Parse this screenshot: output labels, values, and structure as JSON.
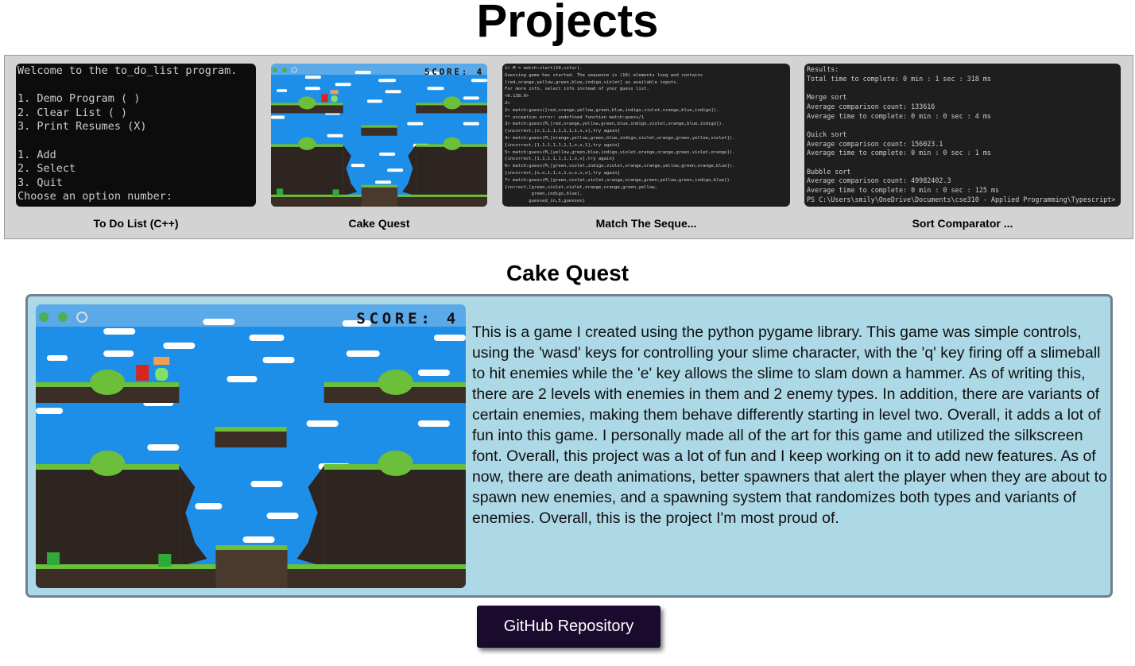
{
  "page": {
    "title": "Projects"
  },
  "projects": [
    {
      "label": "To Do List (C++)",
      "screenshot_lines": [
        "Welcome to the to_do_list program.",
        "",
        "1. Demo Program ( )",
        "2. Clear List ( )",
        "3. Print Resumes (X)",
        "",
        "1. Add",
        "2. Select",
        "3. Quit",
        "Choose an option number:"
      ]
    },
    {
      "label": "Cake Quest",
      "score_text": "SCORE: 4"
    },
    {
      "label": "Match The Seque...",
      "screenshot_lines": [
        "1> M = match:start(10,color).",
        "Guessing game has started. The sequence is (10) elements long and contains",
        "[red,orange,yellow,green,blue,indigo,violet] as available inputs.",
        "For more info, select info instead of your guess list.",
        "<0.138.0>",
        "2>",
        "2> match:guess([red,orange,yellow,green,blue,indigo,violet,orange,blue,indigo]).",
        "** exception error: undefined function match:guess/1",
        "3> match:guess(M,[red,orange,yellow,green,blue,indigo,violet,orange,blue,indigo]).",
        "{incorrect,[x,1,1,1,1,1,1,1,x,x],try again}",
        "4> match:guess(M,[orange,yellow,green,blue,indigo,violet,orange,green,yellow,violet]).",
        "{incorrect,[1,1,1,1,1,1,1,o,x,1],try again}",
        "5> match:guess(M,[yellow,green,blue,indigo,violet,orange,orange,green,violet,orange]).",
        "{incorrect,[1,1,1,1,1,1,1,o,x],try again}",
        "6> match:guess(M,[green,violet,indigo,violet,orange,orange,yellow,green,orange,blue]).",
        "{incorrect,[o,o,1,1,o,1,o,o,x,o],try again}",
        "7> match:guess(M,[green,violet,violet,orange,orange,green,yellow,green,indigo,blue]).",
        "{correct,[green,violet,violet,orange,orange,green,yellow,",
        "          green,indigo,blue],",
        "         guessed_in,5,guesses}",
        "8> "
      ]
    },
    {
      "label": "Sort Comparator ...",
      "screenshot_lines": [
        "Results:",
        "Total time to complete: 0 min : 1 sec : 318 ms",
        "",
        "Merge sort",
        "Average comparison count: 133616",
        "Average time to complete: 0 min : 0 sec : 4 ms",
        "",
        "Quick sort",
        "Average comparison count: 156023.1",
        "Average time to complete: 0 min : 0 sec : 1 ms",
        "",
        "Bubble sort",
        "Average comparison count: 49982402.3",
        "Average time to complete: 0 min : 0 sec : 125 ms",
        "PS C:\\Users\\smily\\OneDrive\\Documents\\cse310 - Applied Programming\\Typescript> "
      ]
    }
  ],
  "detail": {
    "title": "Cake Quest",
    "score_text": "SCORE: 4",
    "description": "This is a game I created using the python pygame library. This game was simple controls, using the 'wasd' keys for controlling your slime character, with the 'q' key firing off a slimeball to hit enemies while the 'e' key allows the slime to slam down a hammer. As of writing this, there are 2 levels with enemies in them and 2 enemy types. In addition, there are variants of certain enemies, making them behave differently starting in level two. Overall, it adds a lot of fun into this game. I personally made all of the art for this game and utilized the silkscreen font. Overall, this project was a lot of fun and I keep working on it to add new features. As of now, there are death animations, better spawners that alert the player when they are about to spawn new enemies, and a spawning system that randomizes both types and variants of enemies. Overall, this is the project I'm most proud of.",
    "github_button": "GitHub Repository"
  },
  "colors": {
    "gallery_bg": "#d3d3d3",
    "panel_bg": "#add8e6",
    "panel_border": "#708090",
    "button_bg": "#1a0a2e",
    "sky": "#1e8fe8",
    "grass": "#6bbf3a",
    "dirt": "#3a2e26"
  }
}
